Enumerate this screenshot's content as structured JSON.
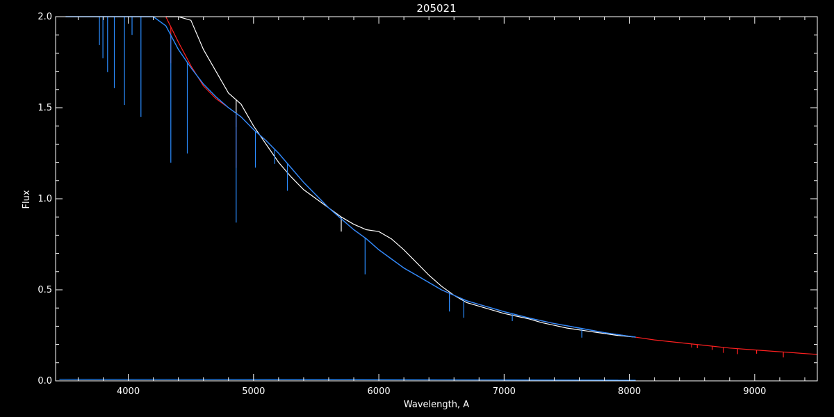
{
  "chart_data": {
    "type": "line",
    "title": "205021",
    "xlabel": "Wavelength, A",
    "ylabel": "Flux",
    "xlim": [
      3420,
      9500
    ],
    "ylim": [
      0,
      2.0
    ],
    "x_major_ticks": [
      4000,
      5000,
      6000,
      7000,
      8000,
      9000
    ],
    "x_tick_labels": [
      "4000",
      "5000",
      "6000",
      "7000",
      "8000",
      "9000"
    ],
    "y_major_ticks": [
      0.0,
      0.5,
      1.0,
      1.5,
      2.0
    ],
    "y_tick_labels": [
      "0.0",
      "0.5",
      "1.0",
      "1.5",
      "2.0"
    ],
    "background_color": "#000000",
    "axes_color": "#ffffff",
    "grid": false,
    "legend": "none",
    "series": [
      {
        "color": "#ffffff",
        "x": [
          4300,
          4400,
          4500,
          4600,
          4700,
          4800,
          4900,
          5000,
          5100,
          5200,
          5300,
          5400,
          5500,
          5600,
          5700,
          5800,
          5900,
          6000,
          6100,
          6200,
          6300,
          6400,
          6500,
          6600,
          6700,
          6800,
          6900,
          7000,
          7100,
          7200,
          7300,
          7400,
          7500,
          7600,
          7700,
          7800,
          7900,
          8050
        ],
        "y": [
          2.05,
          2.02,
          1.98,
          1.82,
          1.7,
          1.58,
          1.52,
          1.4,
          1.3,
          1.2,
          1.12,
          1.05,
          1.0,
          0.95,
          0.9,
          0.86,
          0.83,
          0.82,
          0.78,
          0.72,
          0.65,
          0.58,
          0.52,
          0.47,
          0.43,
          0.41,
          0.39,
          0.37,
          0.355,
          0.34,
          0.32,
          0.305,
          0.29,
          0.28,
          0.27,
          0.26,
          0.25,
          0.24
        ],
        "absorption_lines": [
          {
            "x": 4861,
            "depth": 0.15
          },
          {
            "x": 5700,
            "depth": 0.08
          }
        ]
      },
      {
        "color": "#ff2020",
        "x": [
          4300,
          4400,
          4500,
          4600,
          4700,
          4800,
          4900,
          5000,
          5100,
          5200,
          5300,
          5400,
          5500,
          5600,
          5700,
          5800,
          5900,
          6000,
          6100,
          6200,
          6300,
          6400,
          6500,
          6600,
          6700,
          6800,
          6900,
          7000,
          7200,
          7400,
          7600,
          7800,
          8000,
          8200,
          8400,
          8600,
          8800,
          9000,
          9200,
          9500
        ],
        "y": [
          2.0,
          1.86,
          1.73,
          1.62,
          1.55,
          1.5,
          1.45,
          1.38,
          1.32,
          1.25,
          1.17,
          1.09,
          1.02,
          0.95,
          0.89,
          0.83,
          0.78,
          0.72,
          0.67,
          0.62,
          0.58,
          0.54,
          0.5,
          0.47,
          0.44,
          0.42,
          0.4,
          0.38,
          0.345,
          0.315,
          0.29,
          0.265,
          0.245,
          0.225,
          0.21,
          0.195,
          0.18,
          0.17,
          0.16,
          0.145
        ],
        "absorption_lines": [
          {
            "x": 4340,
            "depth": 0.2
          },
          {
            "x": 4861,
            "depth": 0.3
          },
          {
            "x": 6563,
            "depth": 0.05
          },
          {
            "x": 8498,
            "depth": 0.02
          },
          {
            "x": 8542,
            "depth": 0.02
          },
          {
            "x": 8662,
            "depth": 0.02
          },
          {
            "x": 8750,
            "depth": 0.03
          },
          {
            "x": 8863,
            "depth": 0.03
          },
          {
            "x": 9015,
            "depth": 0.02
          },
          {
            "x": 9229,
            "depth": 0.03
          }
        ]
      },
      {
        "color": "#2a8cff",
        "x": [
          3500,
          3600,
          3700,
          3800,
          3900,
          4000,
          4100,
          4200,
          4300,
          4400,
          4500,
          4600,
          4700,
          4800,
          4900,
          5000,
          5100,
          5200,
          5300,
          5400,
          5500,
          5600,
          5700,
          5800,
          5900,
          6000,
          6100,
          6200,
          6300,
          6400,
          6500,
          6600,
          6700,
          6800,
          6900,
          7000,
          7200,
          7400,
          7600,
          7800,
          8050
        ],
        "y": [
          2.4,
          2.3,
          2.2,
          2.12,
          2.05,
          2.0,
          2.0,
          2.0,
          1.95,
          1.82,
          1.72,
          1.63,
          1.56,
          1.5,
          1.45,
          1.38,
          1.32,
          1.25,
          1.17,
          1.09,
          1.02,
          0.95,
          0.89,
          0.83,
          0.78,
          0.72,
          0.67,
          0.62,
          0.58,
          0.54,
          0.5,
          0.47,
          0.44,
          0.42,
          0.4,
          0.38,
          0.345,
          0.315,
          0.29,
          0.265,
          0.24
        ],
        "absorption_lines": [
          {
            "x": 3770,
            "depth": 0.3
          },
          {
            "x": 3798,
            "depth": 0.35
          },
          {
            "x": 3835,
            "depth": 0.4
          },
          {
            "x": 3889,
            "depth": 0.45
          },
          {
            "x": 3970,
            "depth": 0.5
          },
          {
            "x": 4030,
            "depth": 0.1
          },
          {
            "x": 4101,
            "depth": 0.55
          },
          {
            "x": 4340,
            "depth": 0.7
          },
          {
            "x": 4471,
            "depth": 0.5
          },
          {
            "x": 4861,
            "depth": 0.6
          },
          {
            "x": 5015,
            "depth": 0.2
          },
          {
            "x": 5169,
            "depth": 0.08
          },
          {
            "x": 5270,
            "depth": 0.15
          },
          {
            "x": 5890,
            "depth": 0.2
          },
          {
            "x": 6563,
            "depth": 0.1
          },
          {
            "x": 6678,
            "depth": 0.1
          },
          {
            "x": 7065,
            "depth": 0.04
          },
          {
            "x": 7620,
            "depth": 0.05
          }
        ],
        "baseline": {
          "x": [
            3450,
            8050
          ],
          "y": [
            0.005,
            0.0
          ]
        }
      }
    ]
  }
}
